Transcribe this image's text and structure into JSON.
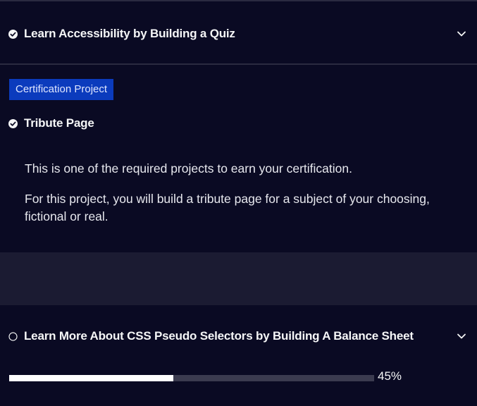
{
  "sections": {
    "accessibility": {
      "title": "Learn Accessibility by Building a Quiz",
      "status_icon": "check-circle-icon",
      "toggle_icon": "chevron-down-icon"
    },
    "tribute": {
      "badge": "Certification Project",
      "title": "Tribute Page",
      "status_icon": "check-circle-icon",
      "paragraph_1": "This is one of the required projects to earn your certification.",
      "paragraph_2": "For this project, you will build a tribute page for a subject of your choosing, fictional or real."
    },
    "balance_sheet": {
      "title": "Learn More About CSS Pseudo Selectors by Building A Balance Sheet",
      "status_icon": "empty-circle-icon",
      "toggle_icon": "chevron-down-icon",
      "progress_value": 0.45,
      "progress_label": "45%"
    }
  },
  "colors": {
    "background": "#0a0a23",
    "gap": "#1b1b32",
    "badge": "#0b3bbd",
    "progress_track": "#3b3b4f",
    "progress_fill": "#ffffff"
  }
}
